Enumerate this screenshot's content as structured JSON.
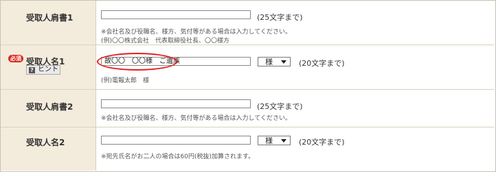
{
  "rows": [
    {
      "label": "受取人肩書1",
      "input_value": "",
      "limit_note": "(25文字まで)",
      "notes": [
        "※会社名及び役職名、様方、気付等がある場合は入力してください。",
        "(例)〇〇株式会社　代表取締役社長、〇〇様方"
      ]
    },
    {
      "label": "受取人名1",
      "required_badge": "必須",
      "hint_button": "ヒント",
      "input_value": "故〇〇　〇〇様　ご遺族",
      "select_value": "様",
      "limit_note": "(20文字まで)",
      "notes": [
        "(例)電報太郎　様"
      ]
    },
    {
      "label": "受取人肩書2",
      "input_value": "",
      "limit_note": "(25文字まで)",
      "notes": [
        "※会社名及び役職名、様方、気付等がある場合は入力してください。"
      ]
    },
    {
      "label": "受取人名2",
      "input_value": "",
      "select_value": "様",
      "limit_note": "(20文字まで)",
      "notes": [
        "※宛先氏名がお二人の場合は60円(税抜)加算されます。"
      ]
    }
  ],
  "colors": {
    "label_bg": "#f3ebdc",
    "required_badge": "#d8291e",
    "annotation_circle": "#e61c1c"
  },
  "icons": {
    "hint": "question-mark-icon",
    "select_arrow": "chevron-down-icon"
  }
}
